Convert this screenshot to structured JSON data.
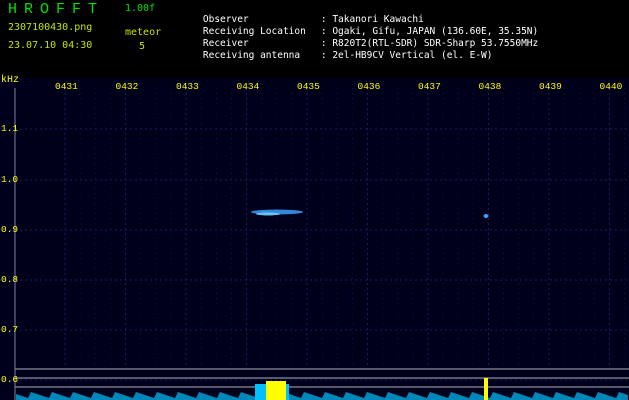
{
  "header": {
    "app_title": "HROFFT",
    "version": "1.00f",
    "filename": "2307100430.png",
    "datetime": "23.07.10 04:30",
    "mode_label": "meteor",
    "mode_value": "5",
    "info": [
      {
        "label": "Observer",
        "value": ": Takanori Kawachi"
      },
      {
        "label": "Receiving Location",
        "value": ": Ogaki, Gifu, JAPAN (136.60E, 35.35N)"
      },
      {
        "label": "Receiver",
        "value": ": R820T2(RTL-SDR) SDR-Sharp 53.7550MHz"
      },
      {
        "label": "Receiving antenna",
        "value": ": 2el-HB9CV Vertical (el. E-W)"
      }
    ]
  },
  "axes": {
    "unit": "kHz",
    "x_ticks": [
      "0431",
      "0432",
      "0433",
      "0434",
      "0435",
      "0436",
      "0437",
      "0438",
      "0439",
      "0440"
    ],
    "y_ticks": [
      "1.1",
      "1.0",
      "0.9",
      "0.8",
      "0.7",
      "0.6"
    ]
  },
  "colors": {
    "background": "#000000",
    "plot_bg": "#00001a",
    "grid": "#1a1a66",
    "tick_label": "#ffff00",
    "title_green": "#00e000",
    "echo": "#3aa0ff",
    "spectrum": "#00c0ff",
    "spectrum_peak": "#ffff00"
  }
}
